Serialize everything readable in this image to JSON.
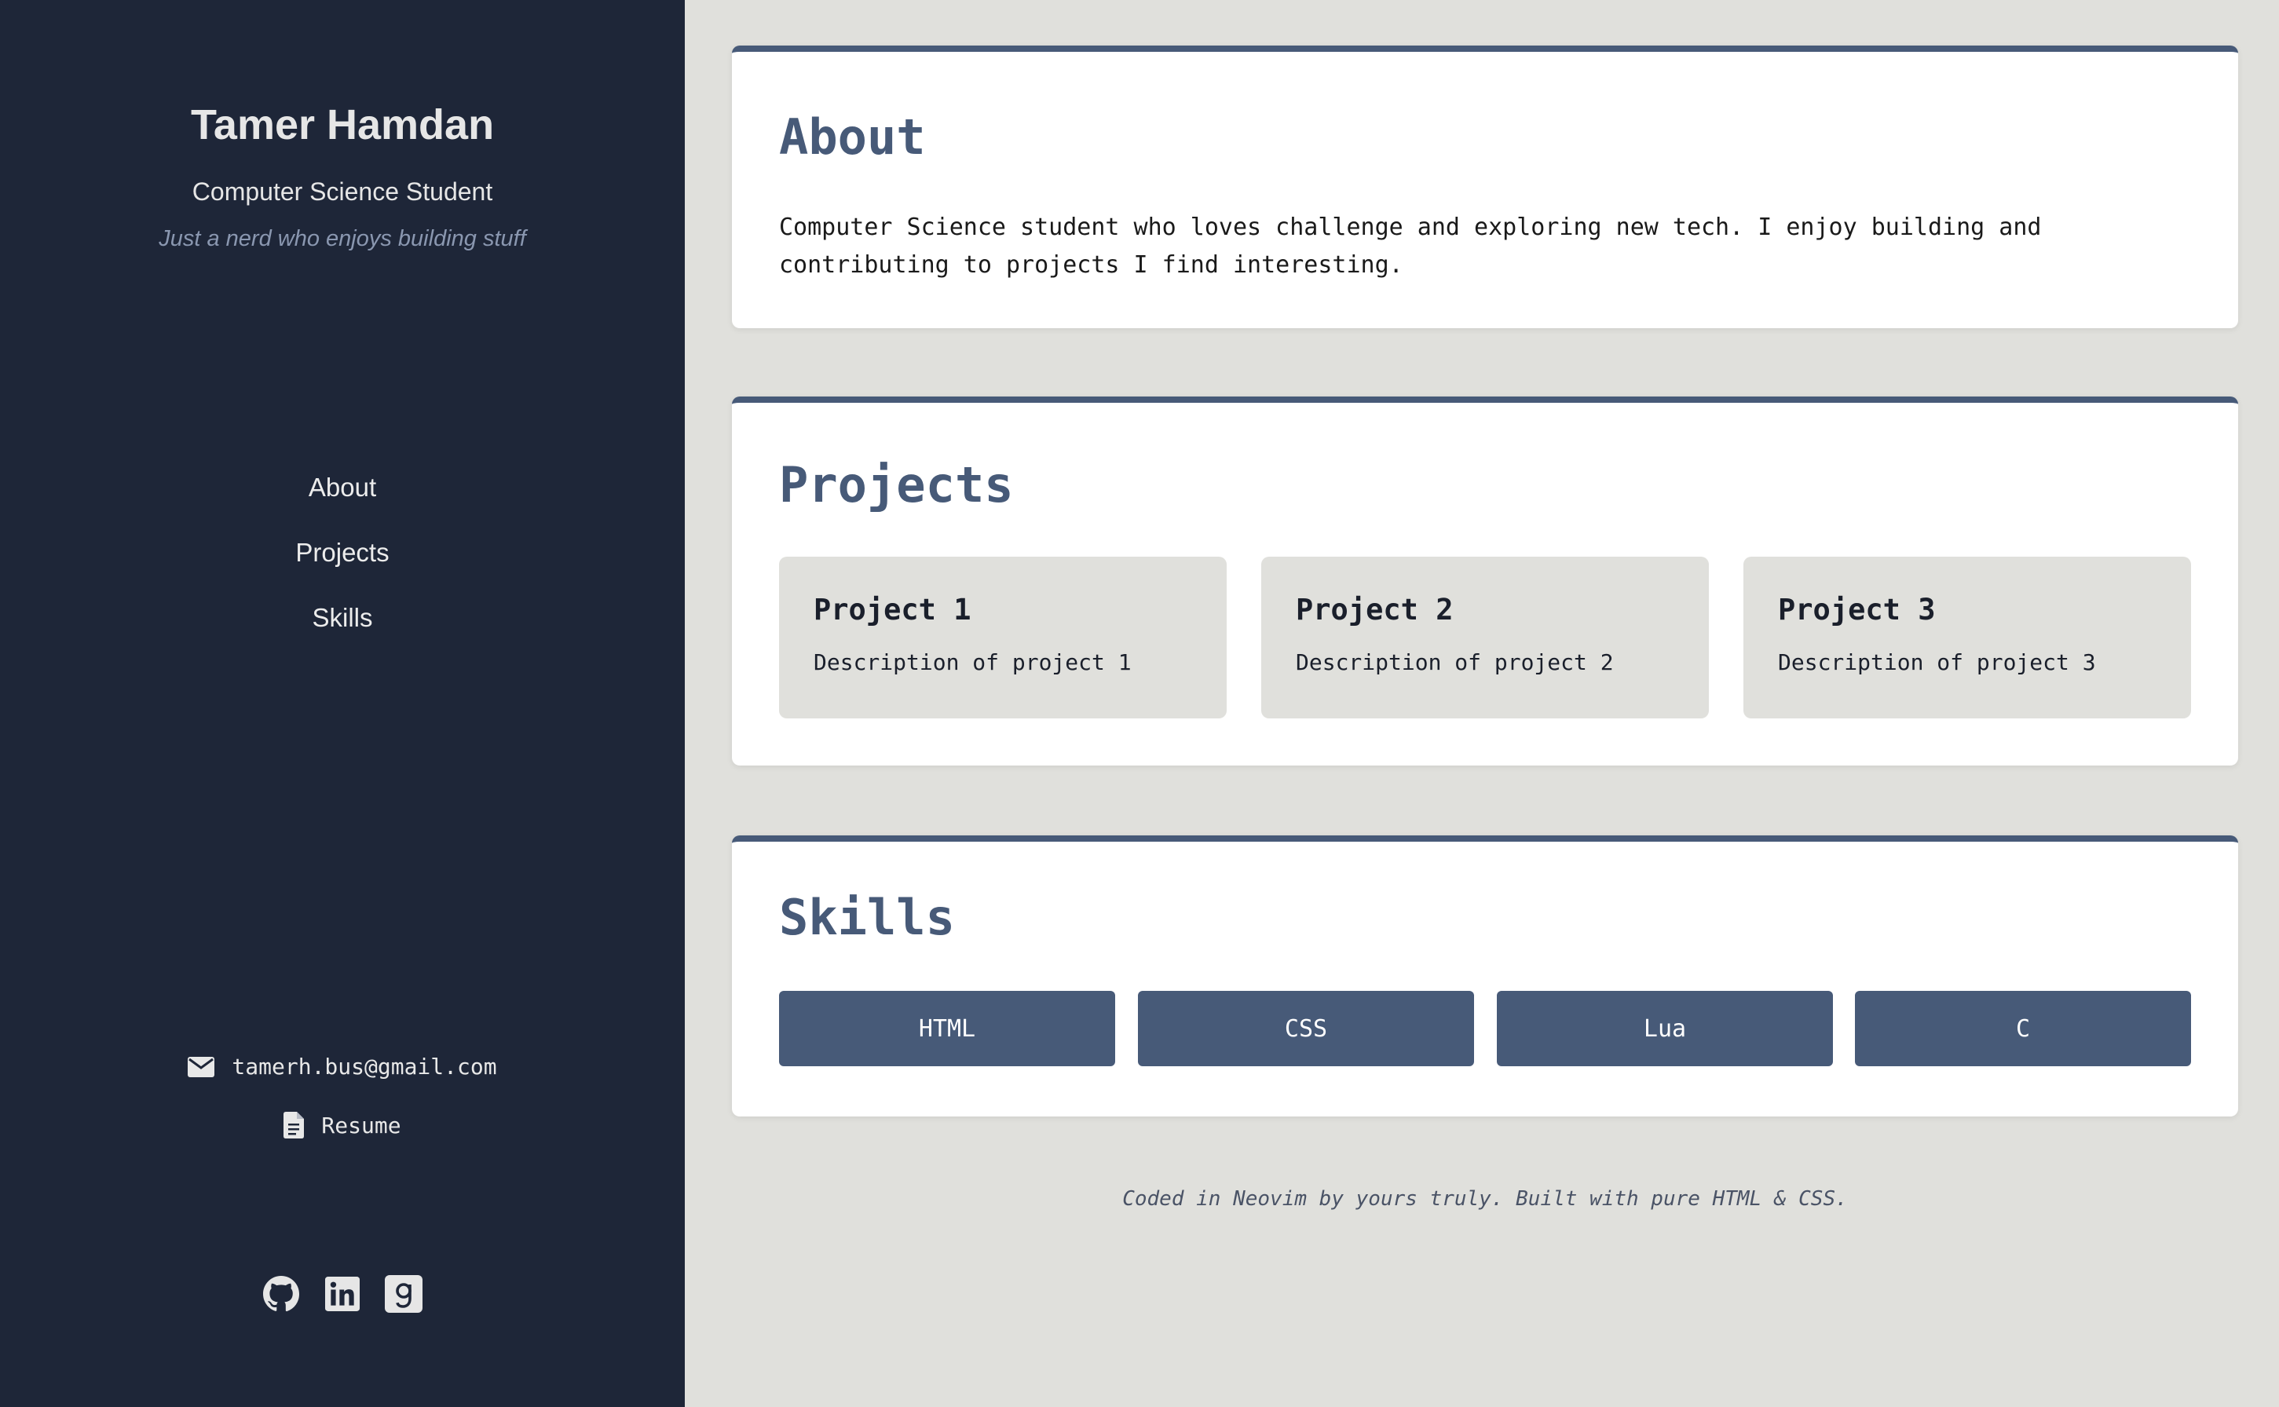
{
  "profile": {
    "name": "Tamer Hamdan",
    "role": "Computer Science Student",
    "tagline": "Just a nerd who enjoys building stuff"
  },
  "nav": {
    "items": [
      {
        "label": "About"
      },
      {
        "label": "Projects"
      },
      {
        "label": "Skills"
      }
    ]
  },
  "contact": {
    "email": "tamerh.bus@gmail.com",
    "email_icon": "envelope-icon",
    "resume_label": "Resume",
    "resume_icon": "document-icon"
  },
  "social": {
    "icons": [
      "github-icon",
      "linkedin-icon",
      "goodreads-icon"
    ]
  },
  "about": {
    "heading": "About",
    "text": "Computer Science student who loves challenge and exploring new tech. I enjoy building and contributing to projects I find interesting."
  },
  "projects": {
    "heading": "Projects",
    "items": [
      {
        "title": "Project 1",
        "description": "Description of project 1"
      },
      {
        "title": "Project 2",
        "description": "Description of project 2"
      },
      {
        "title": "Project 3",
        "description": "Description of project 3"
      }
    ]
  },
  "skills": {
    "heading": "Skills",
    "items": [
      "HTML",
      "CSS",
      "Lua",
      "C"
    ]
  },
  "footer": {
    "text": "Coded in Neovim by yours truly. Built with pure HTML & CSS."
  },
  "colors": {
    "sidebar_bg": "#1e2638",
    "accent": "#475a78",
    "page_bg": "#e0e0dc",
    "card_bg": "#ffffff"
  }
}
